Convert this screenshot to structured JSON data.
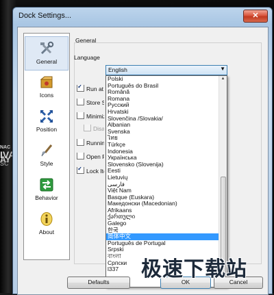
{
  "window": {
    "title": "Dock Settings...",
    "close_glyph": "✕"
  },
  "sidebar": {
    "items": [
      {
        "label": "General",
        "icon": "tools-icon",
        "selected": true
      },
      {
        "label": "Icons",
        "icon": "icons-box-icon",
        "selected": false
      },
      {
        "label": "Position",
        "icon": "position-arrows-icon",
        "selected": false
      },
      {
        "label": "Style",
        "icon": "brush-icon",
        "selected": false
      },
      {
        "label": "Behavior",
        "icon": "behavior-arrows-icon",
        "selected": false
      },
      {
        "label": "About",
        "icon": "info-icon",
        "selected": false
      }
    ]
  },
  "general": {
    "section_title": "General",
    "language_label": "Language",
    "language_value": "English",
    "options": [
      {
        "label": "Run at S",
        "checked": true,
        "enabled": true
      },
      {
        "label": "Store Se",
        "checked": false,
        "enabled": true
      },
      {
        "label": "Minimize",
        "checked": false,
        "enabled": true
      },
      {
        "label": "Disab",
        "checked": false,
        "enabled": false
      },
      {
        "label": "Running",
        "checked": false,
        "enabled": true
      },
      {
        "label": "Open Ru",
        "checked": false,
        "enabled": true
      },
      {
        "label": "Lock Ite",
        "checked": true,
        "enabled": true
      }
    ]
  },
  "language_dropdown": {
    "items": [
      "Polski",
      "Português do Brasil",
      "Română",
      "Romana",
      "Русский",
      "Hrvatski",
      "Slovenčina /Slovakia/",
      "Albanian",
      "Svenska",
      "ไทย",
      "Türkçe",
      "Indonesia",
      "Українська",
      "Slovensko (Slovenija)",
      "Eesti",
      "Lietuvių",
      "فارسی",
      "Việt Nam",
      "Basque (Euskara)",
      "Македонски (Macedonian)",
      "Afrikaans",
      "ქართული",
      "Galego",
      "한국",
      "简体中文",
      "Português de Portugal",
      "Srpski",
      "বাংলা",
      "Српски",
      "l337"
    ],
    "selected": "简体中文"
  },
  "buttons": {
    "defaults": "Defaults",
    "ok": "OK",
    "cancel": "Cancel"
  },
  "desktop_text": {
    "line1": "NAC",
    "line2": "IVA",
    "line3": "SC",
    "line4": "AY"
  },
  "watermark": "极速下载站",
  "colors": {
    "selection": "#3399ff",
    "accent_border": "#3c7fb1",
    "close": "#c23a20"
  }
}
